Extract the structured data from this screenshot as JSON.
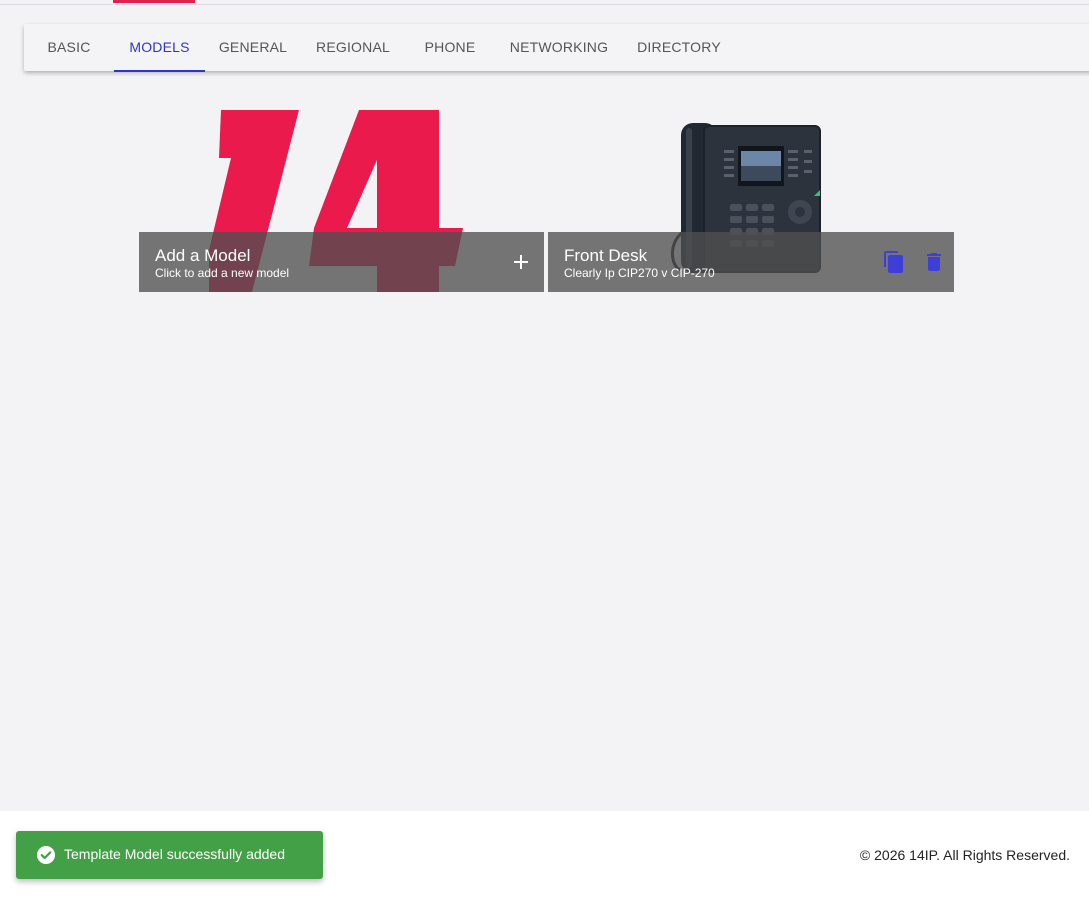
{
  "tabs": [
    {
      "label": "BASIC"
    },
    {
      "label": "MODELS",
      "active": true
    },
    {
      "label": "GENERAL"
    },
    {
      "label": "REGIONAL"
    },
    {
      "label": "PHONE"
    },
    {
      "label": "NETWORKING"
    },
    {
      "label": "DIRECTORY"
    }
  ],
  "cards": {
    "add": {
      "title": "Add a Model",
      "subtitle": "Click to add a new model",
      "icon": "plus-icon"
    },
    "model": {
      "title": "Front Desk",
      "subtitle": "Clearly Ip CIP270 v CIP-270",
      "icons": [
        "copy-icon",
        "delete-icon"
      ]
    }
  },
  "footer": {
    "copyright": "© 2026 14IP. All Rights Reserved."
  },
  "toast": {
    "message": "Template Model successfully added",
    "icon": "check-circle-icon"
  },
  "colors": {
    "accent": "#e0204e",
    "active_tab": "#2f35c6",
    "icon_blue": "#3d3fd8",
    "toast": "#43a047"
  }
}
